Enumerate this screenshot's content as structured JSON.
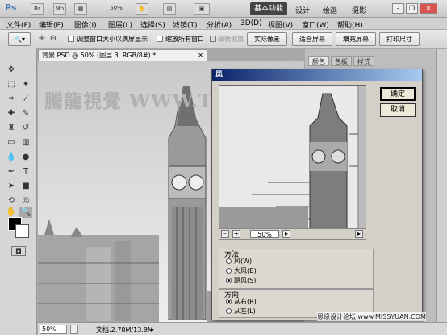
{
  "menubar": {
    "logo": "Ps",
    "mini_buttons": [
      "Br",
      "Mb",
      "50%"
    ],
    "items": [
      "文件(F)",
      "编辑(E)",
      "图像(I)",
      "图层(L)",
      "选择(S)",
      "滤镜(T)",
      "分析(A)",
      "3D(D)",
      "视图(V)",
      "窗口(W)",
      "帮助(H)"
    ],
    "workspaces": [
      "基本功能",
      "设计",
      "绘画",
      "摄影"
    ]
  },
  "options": {
    "chk1": "调整窗口大小以满屏显示",
    "chk2": "缩放所有窗口",
    "chk3": "细微缩放",
    "btn1": "实际像素",
    "btn2": "适合屏幕",
    "btn3": "填充屏幕",
    "btn4": "打印尺寸"
  },
  "document": {
    "tab": "背景.PSD @ 50% (图层 3, RGB/8#) *",
    "zoom": "50%",
    "info": "文档:2.78M/13.9M",
    "watermark": "騰龍視覺 WWW.TLVI.El"
  },
  "panels": {
    "tabs": [
      "颜色",
      "色板",
      "样式"
    ]
  },
  "dialog": {
    "title": "风",
    "ok": "确定",
    "cancel": "取消",
    "zoom": "50%",
    "method": {
      "title": "方法",
      "options": [
        "风(W)",
        "大风(B)",
        "飓风(S)"
      ],
      "selected": 2
    },
    "direction": {
      "title": "方向",
      "options": [
        "从右(R)",
        "从左(L)"
      ],
      "selected": 0
    }
  },
  "credit": "思缘设计论坛 www.MISSYUAN.COM"
}
